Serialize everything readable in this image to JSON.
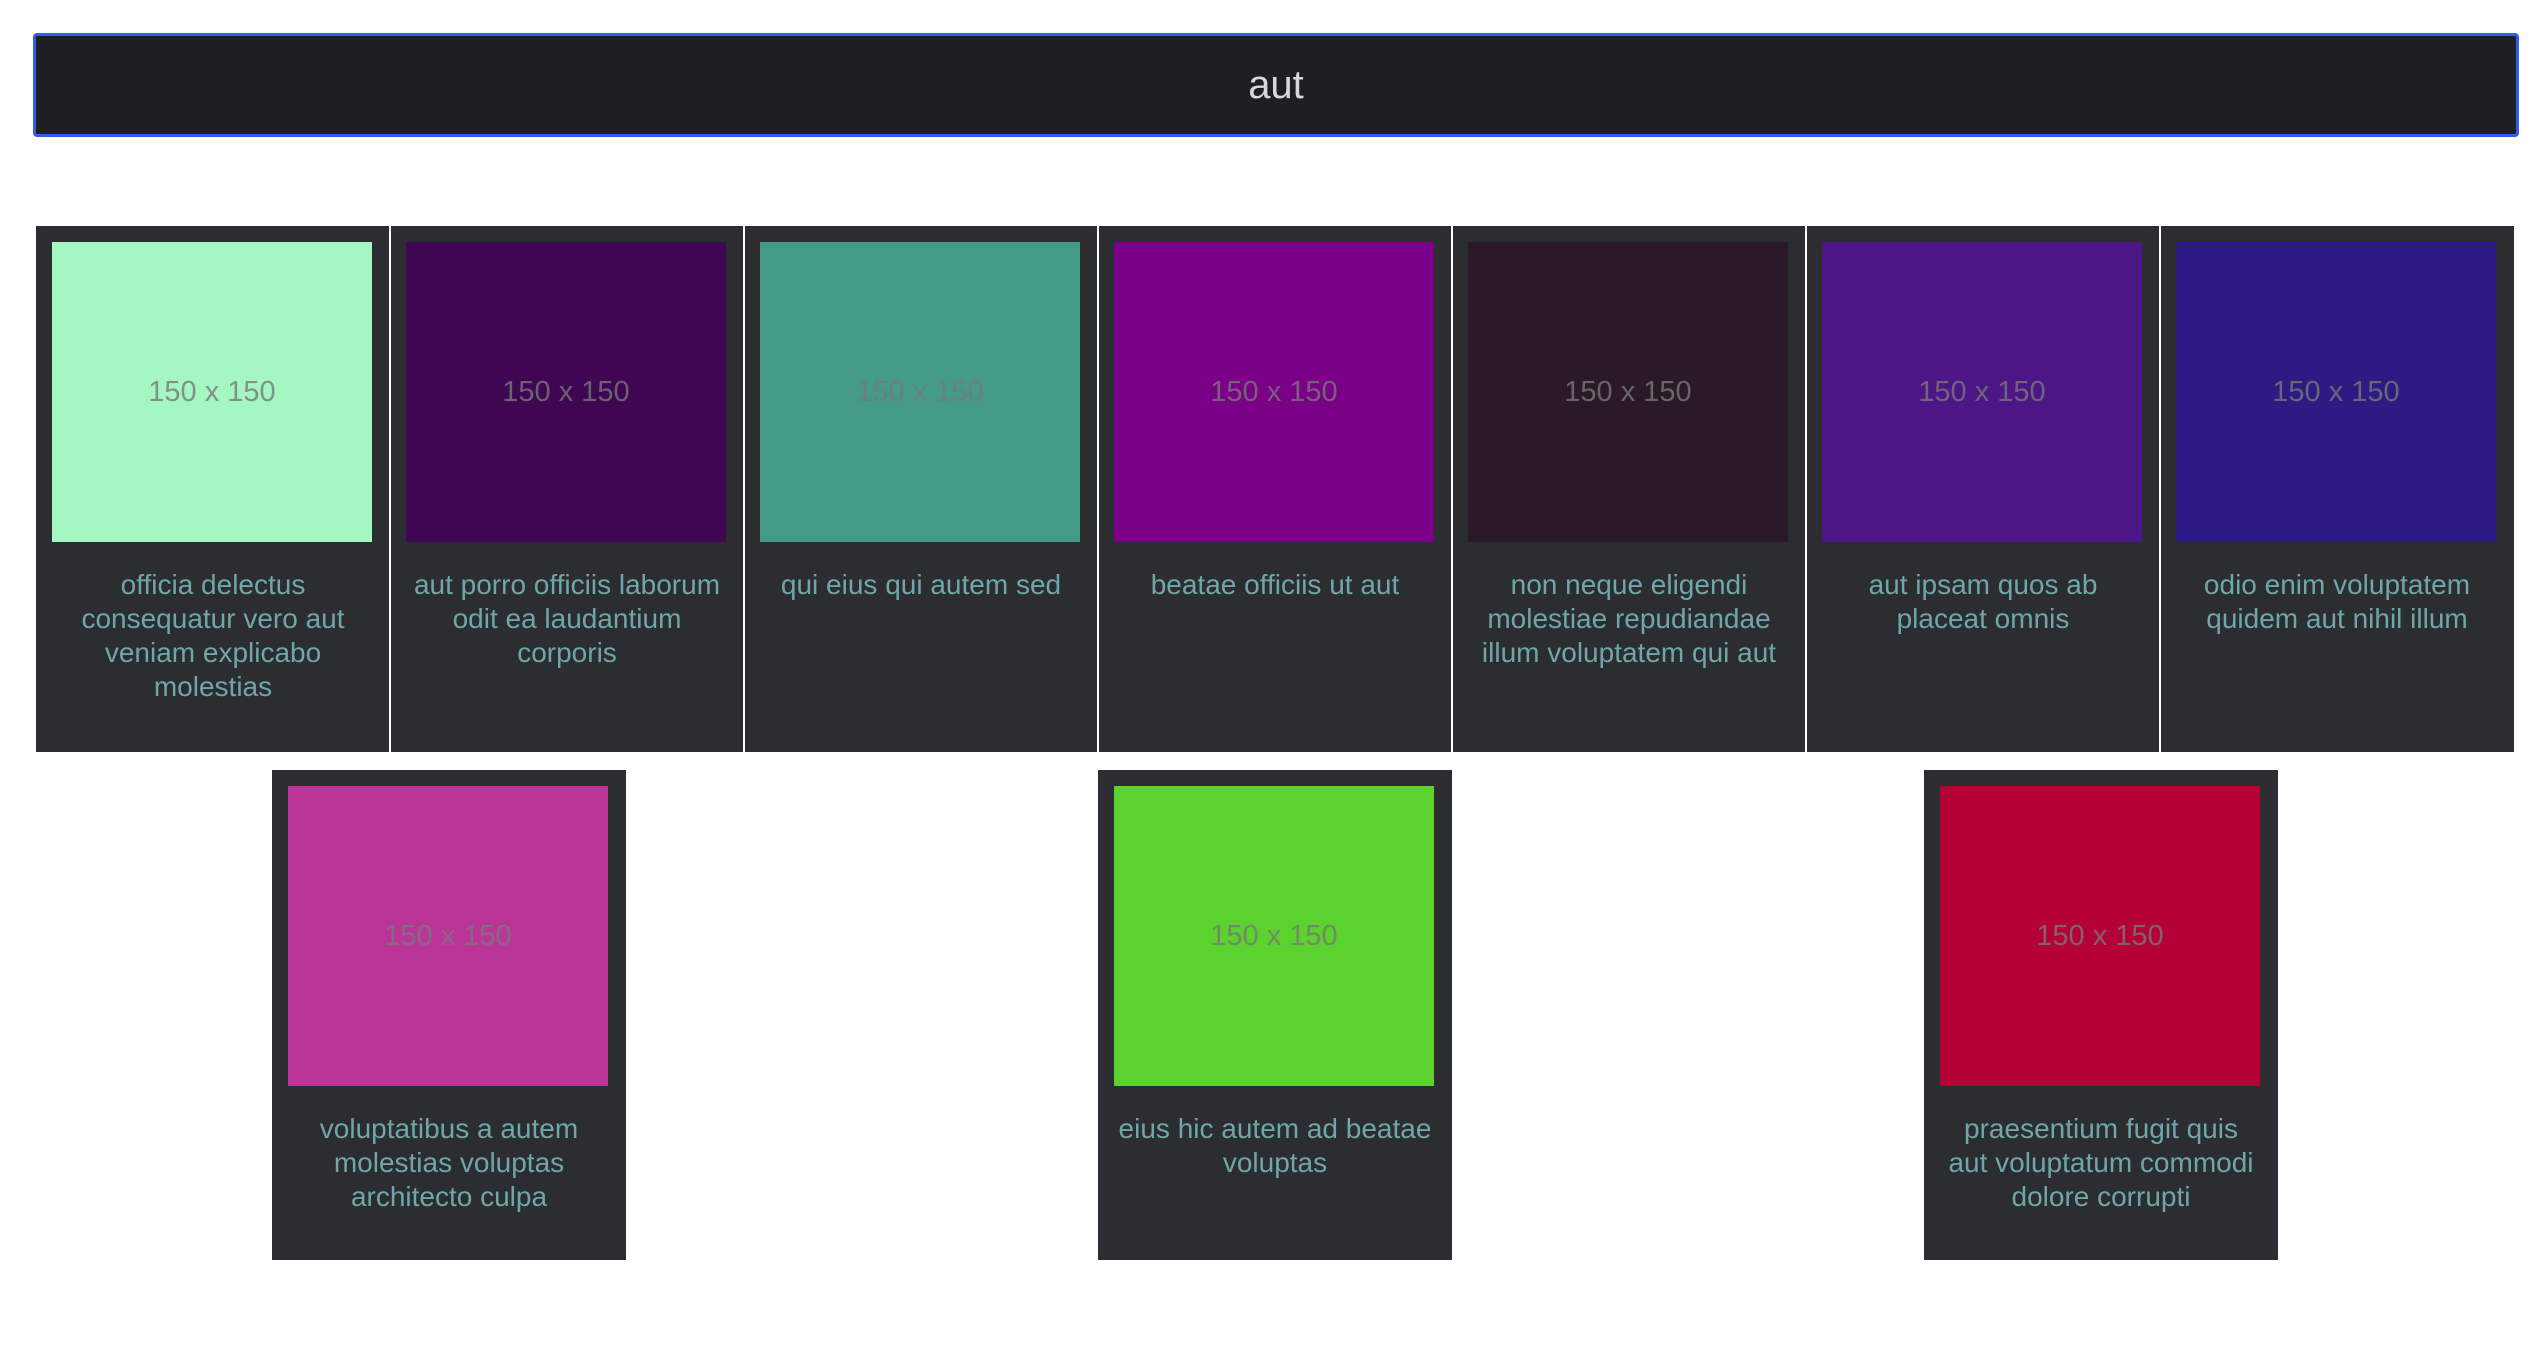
{
  "search": {
    "value": "aut"
  },
  "cards": [
    {
      "title": "officia delectus consequatur vero aut veniam explicabo molestias",
      "placeholder": "150 x 150",
      "color": "#a4f7c3"
    },
    {
      "title": "aut porro officiis laborum odit ea laudantium corporis",
      "placeholder": "150 x 150",
      "color": "#3f0653"
    },
    {
      "title": "qui eius qui autem sed",
      "placeholder": "150 x 150",
      "color": "#439a87"
    },
    {
      "title": "beatae officiis ut aut",
      "placeholder": "150 x 150",
      "color": "#7a0088"
    },
    {
      "title": "non neque eligendi molestiae repudiandae illum voluptatem qui aut",
      "placeholder": "150 x 150",
      "color": "#2a1a29"
    },
    {
      "title": "aut ipsam quos ab placeat omnis",
      "placeholder": "150 x 150",
      "color": "#4c1687"
    },
    {
      "title": "odio enim voluptatem quidem aut nihil illum",
      "placeholder": "150 x 150",
      "color": "#2d1a82"
    },
    {
      "title": "voluptatibus a autem molestias voluptas architecto culpa",
      "placeholder": "150 x 150",
      "color": "#bb3599"
    },
    {
      "title": "eius hic autem ad beatae voluptas",
      "placeholder": "150 x 150",
      "color": "#5bd22d"
    },
    {
      "title": "praesentium fugit quis aut voluptatum commodi dolore corrupti",
      "placeholder": "150 x 150",
      "color": "#b40236"
    }
  ]
}
